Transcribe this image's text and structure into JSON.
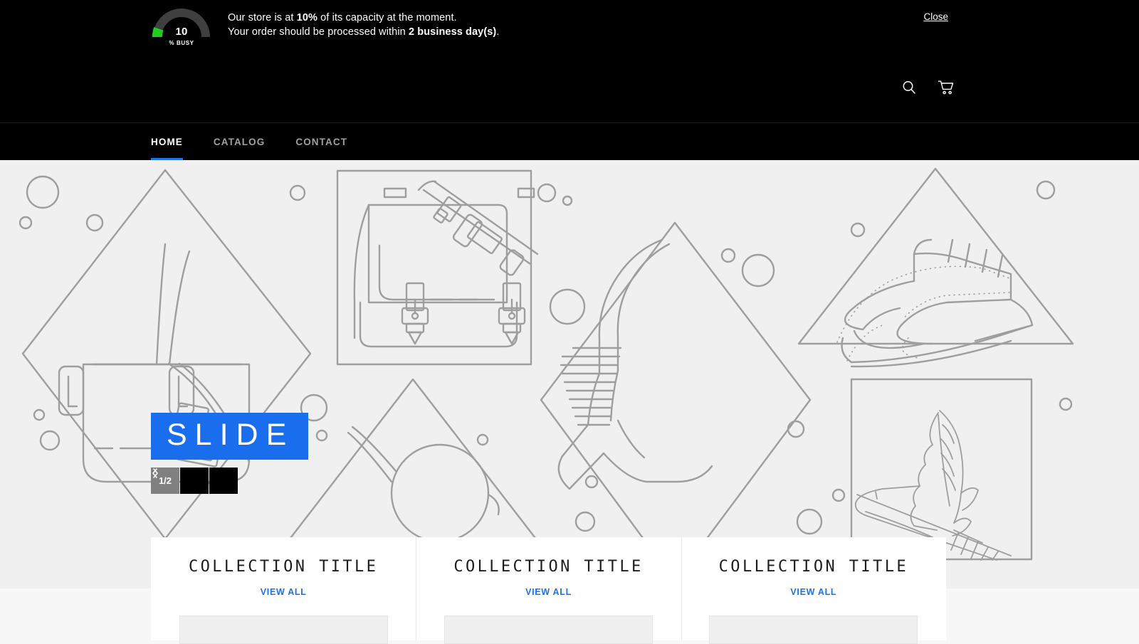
{
  "announcement": {
    "gauge": {
      "value": "10",
      "unit_label": "% BUSY",
      "percent": 10,
      "track_color": "#3f3f3f",
      "fill_color": "#22cc22"
    },
    "line1_prefix": "Our store is at ",
    "line1_strong": "10%",
    "line1_suffix": " of its capacity at the moment.",
    "line2_prefix": "Your order should be processed within ",
    "line2_strong": "2 business day(s)",
    "line2_suffix": ".",
    "close_label": "Close"
  },
  "header": {
    "search_icon": "search-icon",
    "cart_icon": "cart-icon"
  },
  "nav": {
    "items": [
      {
        "label": "HOME",
        "active": true
      },
      {
        "label": "CATALOG",
        "active": false
      },
      {
        "label": "CONTACT",
        "active": false
      }
    ],
    "active_color": "#1a73e8"
  },
  "slideshow": {
    "caption": "SLIDE",
    "caption_bg": "#1a6eed",
    "counter": "1/2",
    "prev_icon": "chevron-left-icon",
    "next_icon": "chevron-right-icon",
    "background_color": "#f0f0f0",
    "line_color": "#9e9e9e"
  },
  "collections": [
    {
      "title": "COLLECTION TITLE",
      "view_all": "VIEW ALL"
    },
    {
      "title": "COLLECTION TITLE",
      "view_all": "VIEW ALL"
    },
    {
      "title": "COLLECTION TITLE",
      "view_all": "VIEW ALL"
    }
  ],
  "colors": {
    "accent_blue": "#1a73e8",
    "page_bg": "#f7f7f7",
    "header_bg": "#000000"
  }
}
